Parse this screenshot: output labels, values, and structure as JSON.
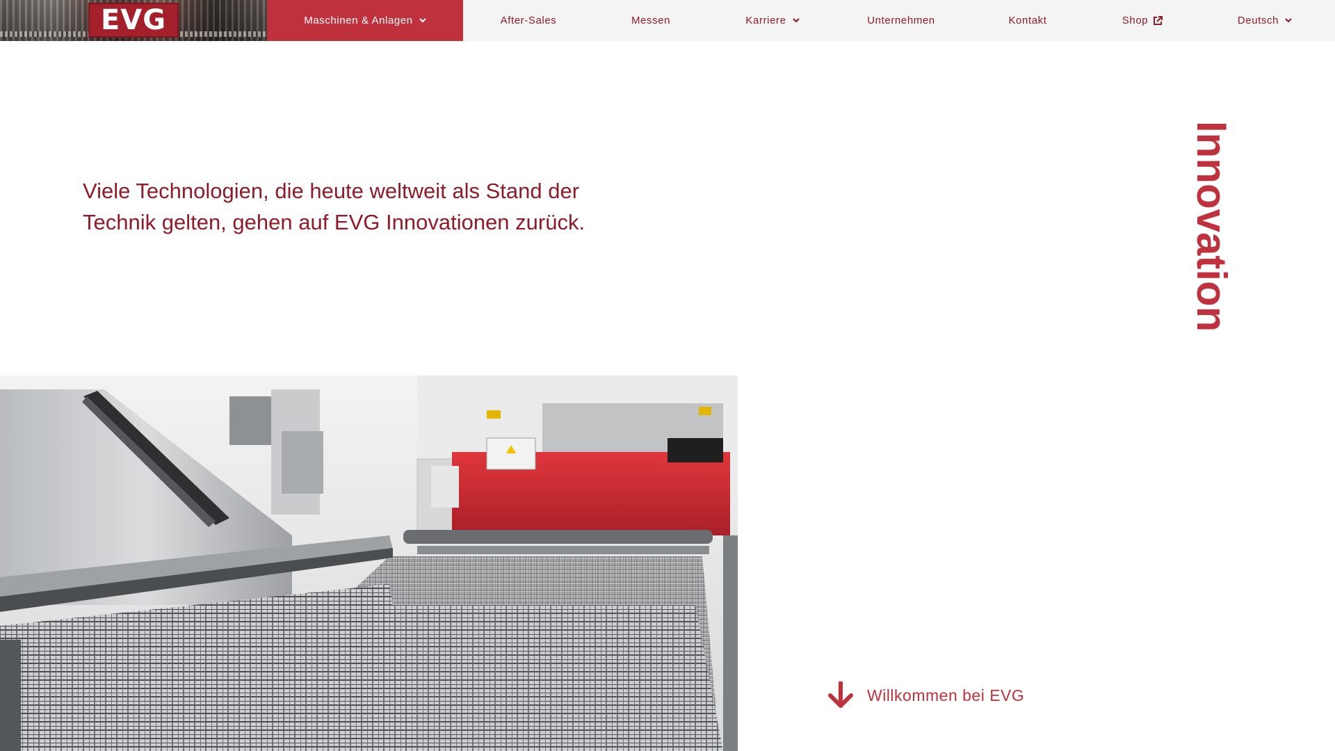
{
  "brand": {
    "logo_text": "EVG",
    "colors": {
      "primary": "#c0313e",
      "dark": "#8f1b28",
      "nav_bg": "#f4f4f4"
    }
  },
  "nav": {
    "items": [
      {
        "label": "Maschinen & Anlagen",
        "active": true,
        "icon": "chevron-down-icon"
      },
      {
        "label": "After-Sales"
      },
      {
        "label": "Messen"
      },
      {
        "label": "Karriere",
        "icon": "chevron-down-icon"
      },
      {
        "label": "Unternehmen"
      },
      {
        "label": "Kontakt"
      },
      {
        "label": "Shop",
        "icon": "external-link-icon"
      },
      {
        "label": "Deutsch",
        "icon": "chevron-down-icon"
      }
    ]
  },
  "hero": {
    "headline_line1": "Viele Technologien, die heute weltweit als Stand der",
    "headline_line2": "Technik gelten, gehen auf EVG Innovationen zurück.",
    "vertical_word": "Innovation",
    "image_icon": "wire-mesh-welding-machine-photo"
  },
  "welcome": {
    "label": "Willkommen bei EVG",
    "icon": "arrow-down-icon"
  }
}
